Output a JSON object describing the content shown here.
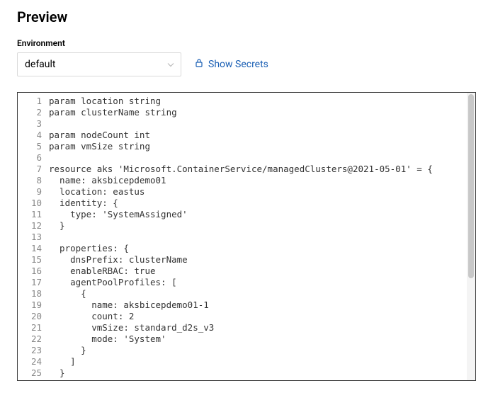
{
  "title": "Preview",
  "environment": {
    "label": "Environment",
    "selected": "default"
  },
  "secrets_button": "Show Secrets",
  "code_lines": [
    "param location string",
    "param clusterName string",
    "",
    "param nodeCount int",
    "param vmSize string",
    "",
    "resource aks 'Microsoft.ContainerService/managedClusters@2021-05-01' = {",
    "  name: aksbicepdemo01",
    "  location: eastus",
    "  identity: {",
    "    type: 'SystemAssigned'",
    "  }",
    "",
    "  properties: {",
    "    dnsPrefix: clusterName",
    "    enableRBAC: true",
    "    agentPoolProfiles: [",
    "      {",
    "        name: aksbicepdemo01-1",
    "        count: 2",
    "        vmSize: standard_d2s_v3",
    "        mode: 'System'",
    "      }",
    "    ]",
    "  }",
    "}"
  ]
}
